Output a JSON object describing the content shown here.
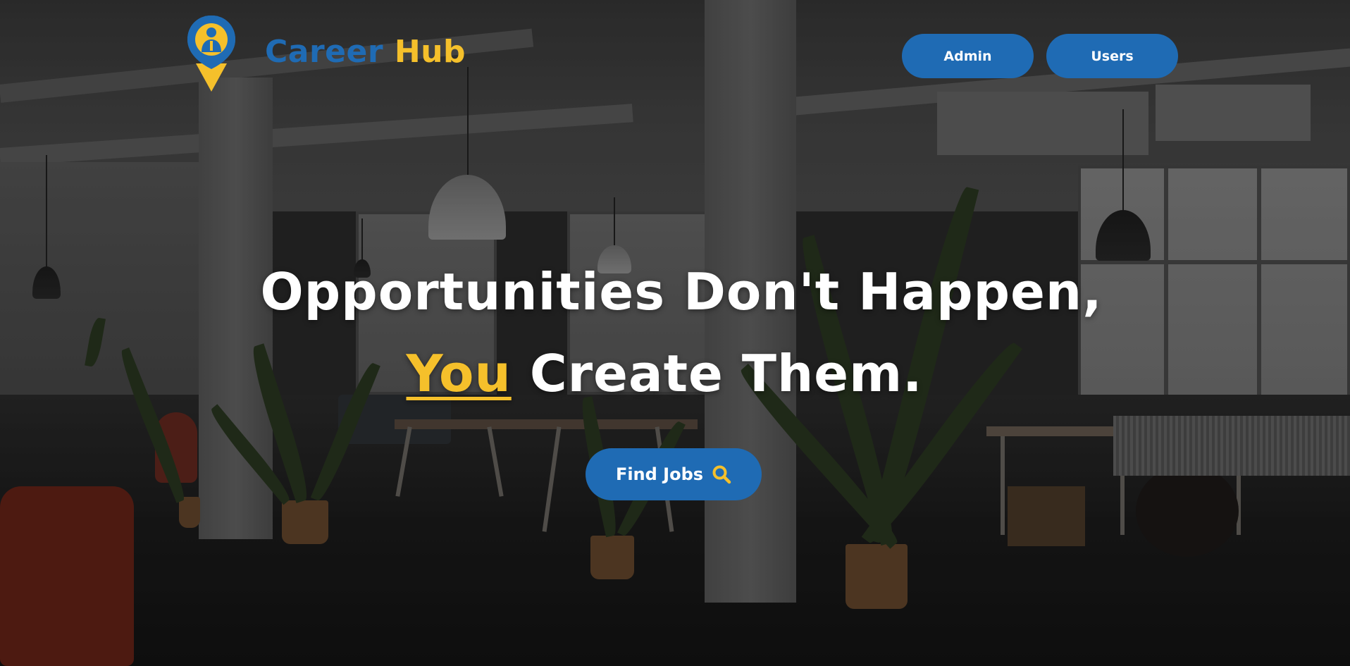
{
  "brand": {
    "name_part1": "Career",
    "name_part2": "Hub",
    "logo_icon": "location-pin-person-icon",
    "colors": {
      "primary_blue": "#1f6bb4",
      "accent_yellow": "#f5c02b"
    }
  },
  "nav": {
    "admin_label": "Admin",
    "users_label": "Users"
  },
  "hero": {
    "line1": "Opportunities Don't Happen,",
    "line2_accent": "You",
    "line2_rest": " Create Them."
  },
  "cta": {
    "label": "Find Jobs",
    "icon": "search-icon"
  },
  "background": {
    "description_icon": "office-photo-background"
  }
}
